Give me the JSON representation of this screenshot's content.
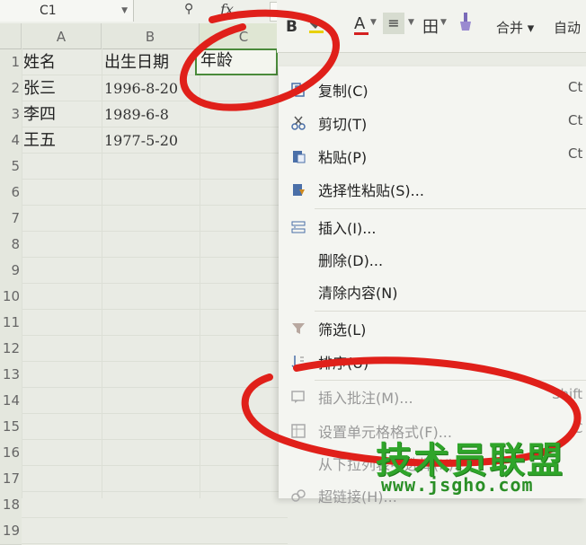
{
  "name_box": {
    "value": "C1"
  },
  "formula_bar": {
    "fx": "fx"
  },
  "columns": [
    "A",
    "B",
    "C"
  ],
  "rows": [
    "1",
    "2",
    "3",
    "4",
    "5",
    "6",
    "7",
    "8",
    "9",
    "10",
    "11",
    "12",
    "13",
    "14",
    "15",
    "16",
    "17",
    "18",
    "19"
  ],
  "cells": {
    "A1": "姓名",
    "B1": "出生日期",
    "C1": "年龄",
    "A2": "张三",
    "B2": "1996-8-20",
    "A3": "李四",
    "B3": "1989-6-8",
    "A4": "王五",
    "B4": "1977-5-20"
  },
  "ribbon": {
    "bold": "B",
    "font_color": "A",
    "merge": "合并",
    "auto": "自动"
  },
  "context_menu": {
    "items": [
      {
        "label": "复制(C)",
        "shortcut": "Ct"
      },
      {
        "label": "剪切(T)",
        "shortcut": "Ct"
      },
      {
        "label": "粘贴(P)",
        "shortcut": "Ct"
      },
      {
        "label": "选择性粘贴(S)...",
        "shortcut": ""
      },
      {
        "label": "插入(I)...",
        "shortcut": ""
      },
      {
        "label": "删除(D)...",
        "shortcut": ""
      },
      {
        "label": "清除内容(N)",
        "shortcut": ""
      },
      {
        "label": "筛选(L)",
        "shortcut": ""
      },
      {
        "label": "排序(U)",
        "shortcut": ""
      },
      {
        "label": "插入批注(M)...",
        "shortcut": "Shift"
      },
      {
        "label": "设置单元格格式(F)...",
        "shortcut": "C"
      },
      {
        "label": "从下拉列表中选择(K)...",
        "shortcut": ""
      },
      {
        "label": "超链接(H)...",
        "shortcut": ""
      }
    ]
  },
  "colors": {
    "annotation": "#e0201a",
    "watermark": "#2fa52a",
    "selection": "#4a8a3a"
  },
  "watermark": {
    "text": "技术员联盟",
    "url": "www.jsgho.com"
  }
}
